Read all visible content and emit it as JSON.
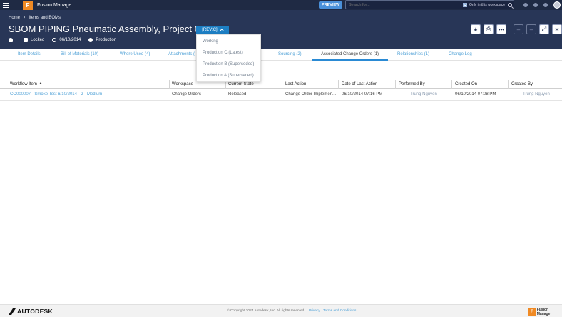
{
  "topbar": {
    "app_name": "Fusion Manage",
    "logo_letter": "F",
    "preview_label": "PREVIEW",
    "search_placeholder": "Search for...",
    "workspace_only_label": "Only in this workspace",
    "workspace_only_checked": true
  },
  "breadcrumb": {
    "home": "Home",
    "section": "Items and BOMs"
  },
  "item": {
    "title": "SBOM PIPING Pneumatic Assembly, Project 621",
    "revision_label": "[REV:C]",
    "lock_status": "Locked",
    "date": "06/10/2014",
    "lifecycle": "Production"
  },
  "actions": {
    "favorite": "★",
    "print": "⎙",
    "more": "•••",
    "prev": "–",
    "next": "–",
    "expand": "⤢",
    "close": "✕"
  },
  "tabs": [
    {
      "label": "Item Details"
    },
    {
      "label": "Bill of Materials (10)"
    },
    {
      "label": "Where Used (4)"
    },
    {
      "label": "Attachments ("
    },
    {
      "label": "Sourcing (2)"
    },
    {
      "label": "Associated Change Orders (1)",
      "active": true
    },
    {
      "label": "Relationships (1)"
    },
    {
      "label": "Change Log"
    }
  ],
  "revision_menu": {
    "items": [
      "Working",
      "Production C (Latest)",
      "Production B (Superseded)",
      "Production A (Superseded)"
    ]
  },
  "table": {
    "columns": [
      "Workflow Item",
      "Workspace",
      "Current State",
      "Last Action",
      "Date of Last Action",
      "Performed By",
      "Created On",
      "Created By"
    ],
    "rows": [
      {
        "workflow_item": "CO000007 - Smoke Test 6/10/2014 - 2 - Medium",
        "workspace": "Change Orders",
        "current_state": "Released",
        "last_action": "Change Order Implemen...",
        "date_of_last_action": "06/10/2014 07:16 PM",
        "performed_by": "Trung Nguyen",
        "created_on": "06/10/2014 07:08 PM",
        "created_by": "Trung Nguyen"
      }
    ]
  },
  "footer": {
    "brand": "AUTODESK",
    "copyright": "© Copyright 2024 Autodesk, Inc. All rights reserved.",
    "privacy": "Privacy",
    "terms": "Terms and Conditions",
    "product_letter": "F",
    "product_name": "Fusion Manage"
  },
  "colors": {
    "topbar": "#1f2a44",
    "header": "#283657",
    "accent": "#1d7fc4",
    "link": "#4b9fd6",
    "logo": "#f08a24"
  }
}
